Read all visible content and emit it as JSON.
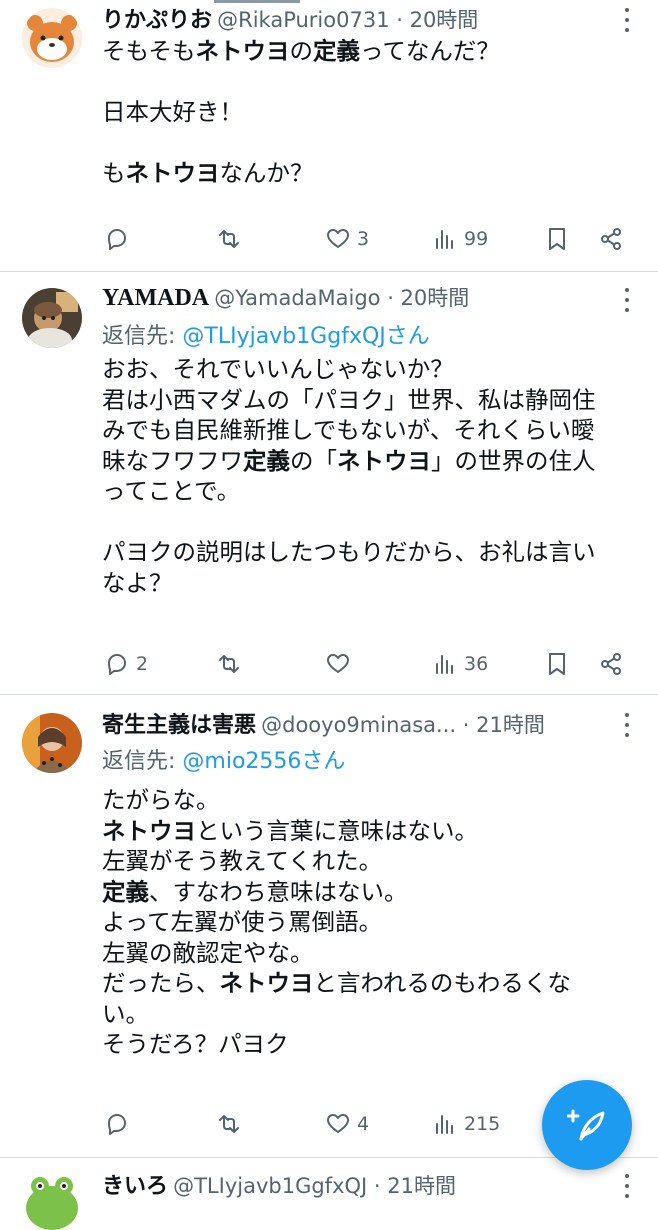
{
  "tweets": [
    {
      "name": "りかぷりお",
      "handle": "@RikaPurio0731 · 20時間",
      "lines": [
        [
          {
            "t": "そもそも"
          },
          {
            "t": "ネトウヨ",
            "b": true
          },
          {
            "t": "の"
          },
          {
            "t": "定義",
            "b": true
          },
          {
            "t": "ってなんだ？"
          }
        ],
        [],
        [
          {
            "t": "日本大好き！"
          }
        ],
        [],
        [
          {
            "t": "も"
          },
          {
            "t": "ネトウヨ",
            "b": true
          },
          {
            "t": "なんか？"
          }
        ]
      ],
      "stats": {
        "replies": "",
        "retweets": "",
        "likes": "3",
        "views": "99"
      }
    },
    {
      "name": "YAMADA",
      "handle": "@YamadaMaigo · 20時間",
      "reply_label": "返信先: ",
      "reply_mention": "@TLIyjavb1GgfxQJさん",
      "lines": [
        [
          {
            "t": "おお、それでいいんじゃないか？"
          }
        ],
        [
          {
            "t": "君は小西マダムの「パヨク」世界、私は静岡住"
          }
        ],
        [
          {
            "t": "みでも自民維新推しでもないが、それくらい曖"
          }
        ],
        [
          {
            "t": "昧なフワフワ"
          },
          {
            "t": "定義",
            "b": true
          },
          {
            "t": "の「"
          },
          {
            "t": "ネトウヨ",
            "b": true
          },
          {
            "t": "」の世界の住人"
          }
        ],
        [
          {
            "t": "ってことで。"
          }
        ],
        [],
        [
          {
            "t": "パヨクの説明はしたつもりだから、お礼は言い"
          }
        ],
        [
          {
            "t": "なよ？"
          }
        ]
      ],
      "stats": {
        "replies": "2",
        "retweets": "",
        "likes": "",
        "views": "36"
      }
    },
    {
      "name": "寄生主義は害悪",
      "handle": "@dooyo9minasa... · 21時間",
      "reply_label": "返信先: ",
      "reply_mention": "@mio2556さん",
      "lines": [
        [
          {
            "t": "たがらな。"
          }
        ],
        [
          {
            "t": "ネトウヨ",
            "b": true
          },
          {
            "t": "という言葉に意味はない。"
          }
        ],
        [
          {
            "t": "左翼がそう教えてくれた。"
          }
        ],
        [
          {
            "t": "定義",
            "b": true
          },
          {
            "t": "、すなわち意味はない。"
          }
        ],
        [
          {
            "t": "よって左翼が使う罵倒語。"
          }
        ],
        [
          {
            "t": "左翼の敵認定やな。"
          }
        ],
        [
          {
            "t": "だったら、"
          },
          {
            "t": "ネトウヨ",
            "b": true
          },
          {
            "t": "と言われるのもわるくな"
          }
        ],
        [
          {
            "t": "い。"
          }
        ],
        [
          {
            "t": "そうだろ？パヨク"
          }
        ]
      ],
      "stats": {
        "replies": "",
        "retweets": "",
        "likes": "4",
        "views": "215"
      }
    },
    {
      "name": "きいろ",
      "handle": "@TLIyjavb1GgfxQJ · 21時間"
    }
  ],
  "colors": {
    "accent": "#1d9bf0",
    "muted": "#536471",
    "text": "#0f1419"
  },
  "icons": [
    "reply-icon",
    "retweet-icon",
    "like-icon",
    "views-icon",
    "bookmark-icon",
    "share-icon",
    "more-icon",
    "compose-icon"
  ]
}
